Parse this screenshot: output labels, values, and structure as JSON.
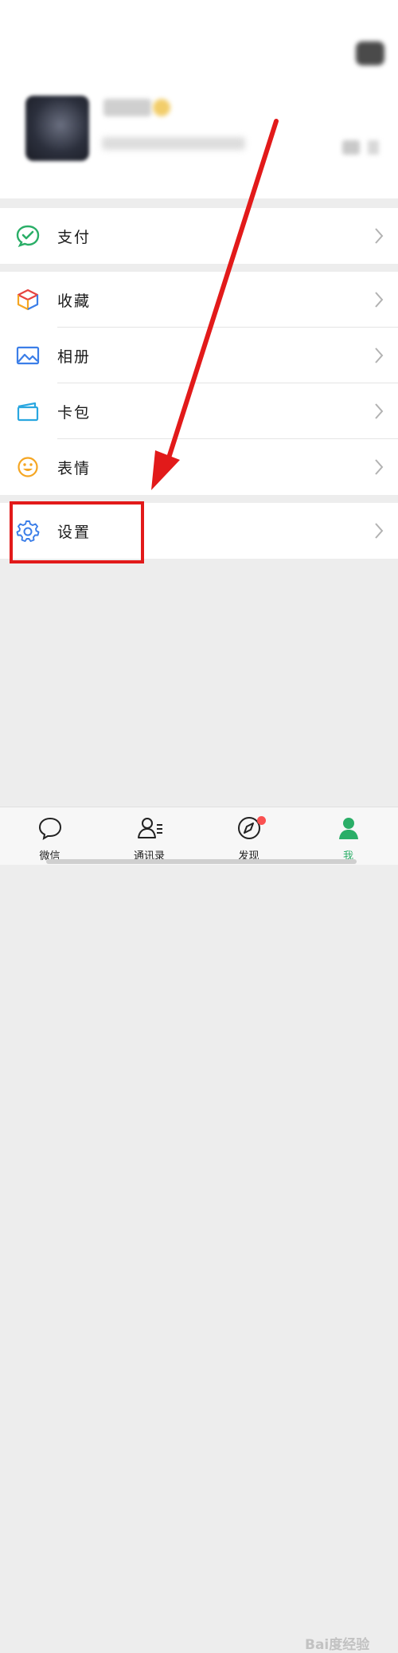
{
  "menu": {
    "pay": "支付",
    "favorites": "收藏",
    "album": "相册",
    "cards": "卡包",
    "stickers": "表情",
    "settings": "设置"
  },
  "tabbar": {
    "chats": "微信",
    "contacts": "通讯录",
    "discover": "发现",
    "me": "我"
  },
  "watermark": "Bai度经验",
  "colors": {
    "accent": "#2aae67",
    "highlight": "#e21a1a",
    "badge": "#fa5151",
    "background": "#ededed"
  }
}
